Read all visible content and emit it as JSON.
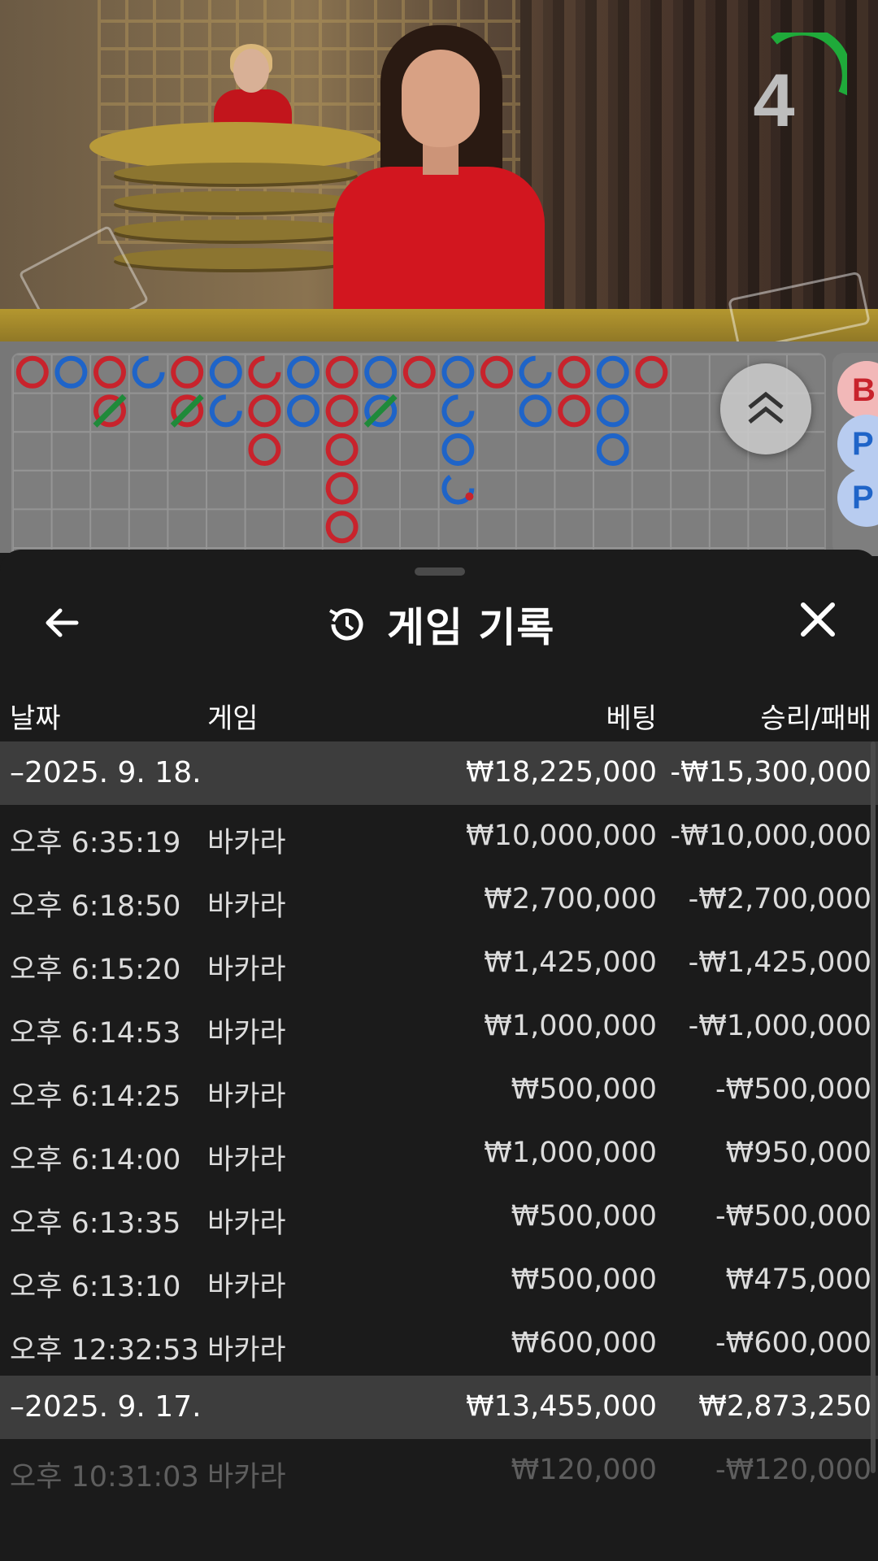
{
  "timer": {
    "count": "4",
    "color": "#1faa3a"
  },
  "roadmap": {
    "red": "#c8232c",
    "blue": "#1f64c8",
    "tie_mark": "#1f8a3a",
    "side_badges": [
      "B",
      "P",
      "P"
    ]
  },
  "panel": {
    "title": "게임 기록",
    "back_icon": "arrow-left-icon",
    "history_icon": "history-clock-icon",
    "close_icon": "close-icon"
  },
  "columns": {
    "date": "날짜",
    "game": "게임",
    "bet": "베팅",
    "winloss": "승리/패배"
  },
  "rows": [
    {
      "type": "group",
      "date": "–2025. 9. 18.",
      "game": "",
      "bet": "₩18,225,000",
      "winloss": "-₩15,300,000"
    },
    {
      "type": "item",
      "date": "오후 6:35:19",
      "game": "바카라",
      "bet": "₩10,000,000",
      "winloss": "-₩10,000,000"
    },
    {
      "type": "item",
      "date": "오후 6:18:50",
      "game": "바카라",
      "bet": "₩2,700,000",
      "winloss": "-₩2,700,000"
    },
    {
      "type": "item",
      "date": "오후 6:15:20",
      "game": "바카라",
      "bet": "₩1,425,000",
      "winloss": "-₩1,425,000"
    },
    {
      "type": "item",
      "date": "오후 6:14:53",
      "game": "바카라",
      "bet": "₩1,000,000",
      "winloss": "-₩1,000,000"
    },
    {
      "type": "item",
      "date": "오후 6:14:25",
      "game": "바카라",
      "bet": "₩500,000",
      "winloss": "-₩500,000"
    },
    {
      "type": "item",
      "date": "오후 6:14:00",
      "game": "바카라",
      "bet": "₩1,000,000",
      "winloss": "₩950,000"
    },
    {
      "type": "item",
      "date": "오후 6:13:35",
      "game": "바카라",
      "bet": "₩500,000",
      "winloss": "-₩500,000"
    },
    {
      "type": "item",
      "date": "오후 6:13:10",
      "game": "바카라",
      "bet": "₩500,000",
      "winloss": "₩475,000"
    },
    {
      "type": "item",
      "date": "오후 12:32:53",
      "game": "바카라",
      "bet": "₩600,000",
      "winloss": "-₩600,000"
    },
    {
      "type": "group",
      "date": "–2025. 9. 17.",
      "game": "",
      "bet": "₩13,455,000",
      "winloss": "₩2,873,250"
    },
    {
      "type": "item",
      "date": "오후 10:31:03",
      "game": "바카라",
      "bet": "₩120,000",
      "winloss": "-₩120,000",
      "faded": true
    }
  ]
}
